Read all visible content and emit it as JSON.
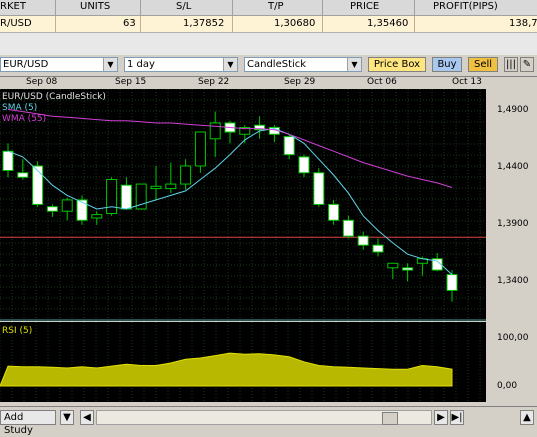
{
  "table": {
    "headers": [
      "RKET",
      "UNITS",
      "S/L",
      "T/P",
      "PRICE",
      "PROFIT(PIPS)"
    ],
    "row": [
      "R/USD",
      "63",
      "1,37852",
      "1,30680",
      "1,35460",
      "138,7"
    ]
  },
  "toolbar": {
    "symbol": "EUR/USD",
    "timeframe": "1 day",
    "chart_type": "CandleStick",
    "pricebox_label": "Price Box",
    "buy_label": "Buy",
    "sell_label": "Sell"
  },
  "dates": [
    "Sep 08",
    "Sep 15",
    "Sep 22",
    "Sep 29",
    "Oct 06",
    "Oct 13"
  ],
  "legend": {
    "main": "EUR/USD (CandleStick)",
    "sma": "SMA (5)",
    "wma": "WMA (55)",
    "rsi": "RSI (5)"
  },
  "yaxis": [
    "1,4900",
    "1,4400",
    "1,3900",
    "1,3400"
  ],
  "rsi_axis": [
    "100,00",
    "0,00"
  ],
  "bottom": {
    "add_study": "Add Study"
  },
  "colors": {
    "sma": "#5fd3e8",
    "wma": "#d23fd6",
    "candle_up": "#00c800",
    "rsi_fill": "#b8b800",
    "line": "#e04040"
  },
  "chart_data": {
    "type": "candlestick",
    "ylim": [
      1.305,
      1.51
    ],
    "candles": [
      {
        "o": 1.455,
        "h": 1.462,
        "l": 1.432,
        "c": 1.438
      },
      {
        "o": 1.436,
        "h": 1.448,
        "l": 1.43,
        "c": 1.432
      },
      {
        "o": 1.442,
        "h": 1.446,
        "l": 1.406,
        "c": 1.408
      },
      {
        "o": 1.406,
        "h": 1.408,
        "l": 1.397,
        "c": 1.402
      },
      {
        "o": 1.402,
        "h": 1.414,
        "l": 1.394,
        "c": 1.412
      },
      {
        "o": 1.412,
        "h": 1.416,
        "l": 1.39,
        "c": 1.394
      },
      {
        "o": 1.396,
        "h": 1.402,
        "l": 1.39,
        "c": 1.399
      },
      {
        "o": 1.4,
        "h": 1.432,
        "l": 1.398,
        "c": 1.43
      },
      {
        "o": 1.425,
        "h": 1.432,
        "l": 1.404,
        "c": 1.404
      },
      {
        "o": 1.404,
        "h": 1.426,
        "l": 1.404,
        "c": 1.426
      },
      {
        "o": 1.422,
        "h": 1.442,
        "l": 1.412,
        "c": 1.424
      },
      {
        "o": 1.422,
        "h": 1.445,
        "l": 1.418,
        "c": 1.426
      },
      {
        "o": 1.426,
        "h": 1.448,
        "l": 1.421,
        "c": 1.442
      },
      {
        "o": 1.442,
        "h": 1.472,
        "l": 1.436,
        "c": 1.472
      },
      {
        "o": 1.466,
        "h": 1.49,
        "l": 1.45,
        "c": 1.48
      },
      {
        "o": 1.48,
        "h": 1.482,
        "l": 1.462,
        "c": 1.472
      },
      {
        "o": 1.47,
        "h": 1.478,
        "l": 1.462,
        "c": 1.476
      },
      {
        "o": 1.478,
        "h": 1.486,
        "l": 1.466,
        "c": 1.474
      },
      {
        "o": 1.476,
        "h": 1.478,
        "l": 1.463,
        "c": 1.47
      },
      {
        "o": 1.468,
        "h": 1.47,
        "l": 1.448,
        "c": 1.452
      },
      {
        "o": 1.45,
        "h": 1.452,
        "l": 1.432,
        "c": 1.436
      },
      {
        "o": 1.436,
        "h": 1.44,
        "l": 1.406,
        "c": 1.408
      },
      {
        "o": 1.408,
        "h": 1.412,
        "l": 1.39,
        "c": 1.394
      },
      {
        "o": 1.394,
        "h": 1.398,
        "l": 1.378,
        "c": 1.38
      },
      {
        "o": 1.38,
        "h": 1.384,
        "l": 1.368,
        "c": 1.372
      },
      {
        "o": 1.372,
        "h": 1.378,
        "l": 1.362,
        "c": 1.366
      },
      {
        "o": 1.352,
        "h": 1.356,
        "l": 1.342,
        "c": 1.356
      },
      {
        "o": 1.352,
        "h": 1.356,
        "l": 1.34,
        "c": 1.35
      },
      {
        "o": 1.356,
        "h": 1.362,
        "l": 1.345,
        "c": 1.36
      },
      {
        "o": 1.36,
        "h": 1.365,
        "l": 1.349,
        "c": 1.35
      },
      {
        "o": 1.346,
        "h": 1.35,
        "l": 1.322,
        "c": 1.332
      }
    ],
    "sma": [
      1.455,
      1.45,
      1.438,
      1.425,
      1.416,
      1.41,
      1.404,
      1.406,
      1.404,
      1.408,
      1.412,
      1.416,
      1.42,
      1.43,
      1.44,
      1.452,
      1.465,
      1.473,
      1.475,
      1.47,
      1.462,
      1.448,
      1.434,
      1.418,
      1.398,
      1.385,
      1.374,
      1.364,
      1.36,
      1.358,
      1.346
    ],
    "wma": [
      1.492,
      1.49,
      1.488,
      1.486,
      1.485,
      1.484,
      1.483,
      1.482,
      1.482,
      1.481,
      1.48,
      1.48,
      1.479,
      1.478,
      1.477,
      1.476,
      1.475,
      1.475,
      1.474,
      1.47,
      1.465,
      1.46,
      1.455,
      1.45,
      1.445,
      1.441,
      1.437,
      1.433,
      1.43,
      1.427,
      1.423
    ],
    "red_line": 1.379,
    "rsi_series": [
      45,
      44,
      44,
      43,
      42,
      44,
      42,
      45,
      48,
      46,
      46,
      50,
      56,
      58,
      62,
      66,
      64,
      65,
      63,
      60,
      52,
      46,
      44,
      43,
      42,
      41,
      40,
      40,
      46,
      44,
      40
    ]
  }
}
